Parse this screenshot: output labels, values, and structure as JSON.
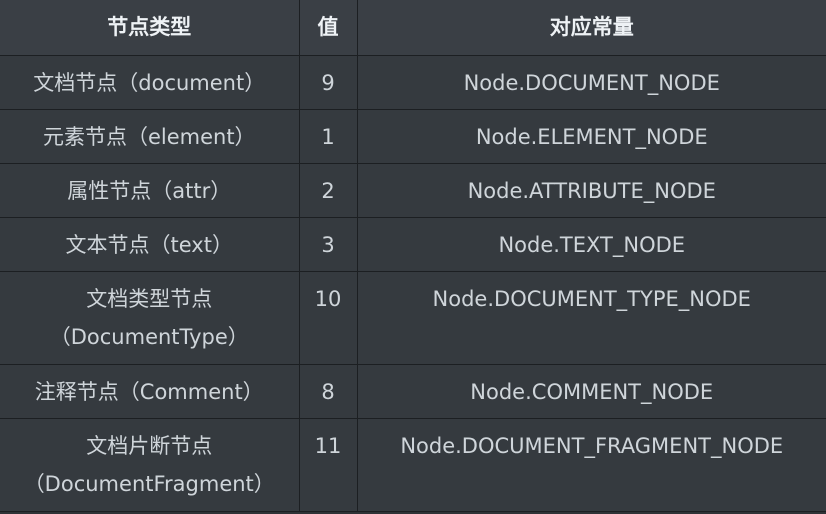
{
  "table": {
    "headers": [
      "节点类型",
      "值",
      "对应常量"
    ],
    "rows": [
      {
        "type": "文档节点（document）",
        "value": "9",
        "constant": "Node.DOCUMENT_NODE"
      },
      {
        "type": "元素节点（element）",
        "value": "1",
        "constant": "Node.ELEMENT_NODE"
      },
      {
        "type": "属性节点（attr）",
        "value": "2",
        "constant": "Node.ATTRIBUTE_NODE"
      },
      {
        "type": "文本节点（text）",
        "value": "3",
        "constant": "Node.TEXT_NODE"
      },
      {
        "type": "文档类型节点（DocumentType）",
        "value": "10",
        "constant": "Node.DOCUMENT_TYPE_NODE"
      },
      {
        "type": "注释节点（Comment）",
        "value": "8",
        "constant": "Node.COMMENT_NODE"
      },
      {
        "type": "文档片断节点（DocumentFragment）",
        "value": "11",
        "constant": "Node.DOCUMENT_FRAGMENT_NODE"
      }
    ]
  }
}
